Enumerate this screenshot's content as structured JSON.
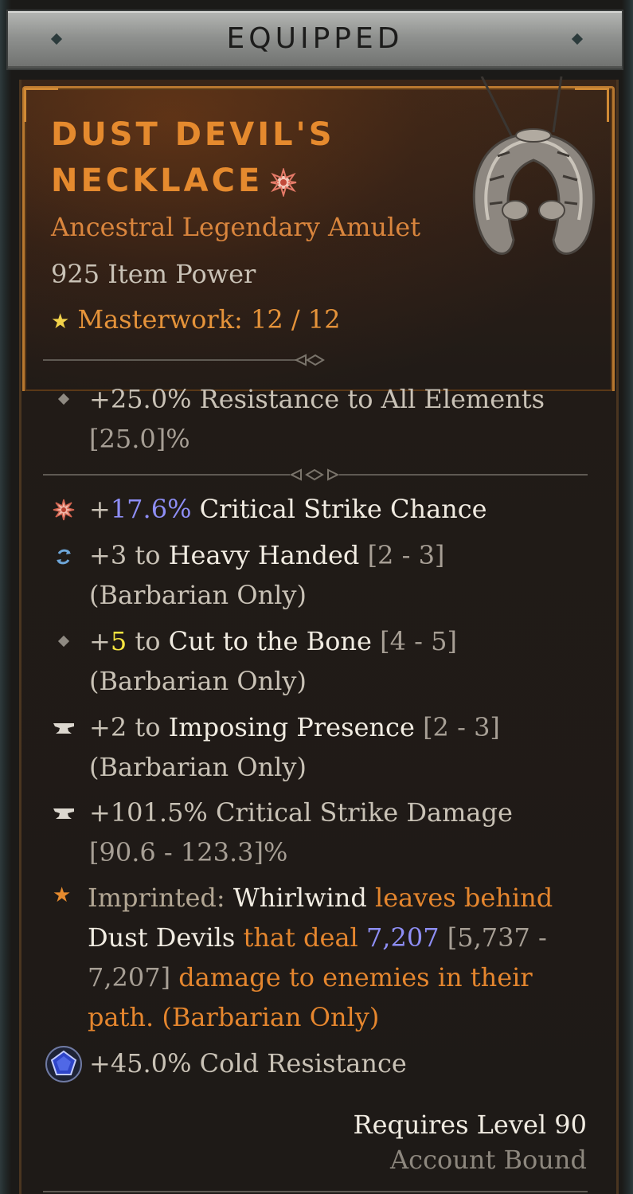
{
  "header": {
    "title": "EQUIPPED"
  },
  "item": {
    "name_line1": "DUST DEVIL'S",
    "name_line2": "NECKLACE",
    "greater_icon": "greater-affix-icon",
    "type": "Ancestral Legendary Amulet",
    "item_power": "925 Item Power",
    "masterwork_label": "Masterwork: 12 / 12",
    "masterwork_icon": "star-icon"
  },
  "implicit": {
    "line1": "+25.0% Resistance to All Elements",
    "line2": "[25.0]%"
  },
  "affixes": [
    {
      "icon": "greater-affix-icon",
      "prefix": "+",
      "value": "17.6%",
      "rest": " Critical Strike Chance"
    },
    {
      "icon": "tempered-affix-icon",
      "prefix": "+3 to ",
      "name": "Heavy Handed",
      "range": " [2 - 3]",
      "line2": "(Barbarian Only)"
    },
    {
      "icon": "diamond-icon",
      "prefix": "+",
      "value": "5",
      "mid": " to ",
      "name": "Cut to the Bone",
      "range": " [4 - 5]",
      "line2": "(Barbarian Only)"
    },
    {
      "icon": "anvil-icon",
      "prefix": "+2 to ",
      "name": "Imposing Presence",
      "range": "  [2 - 3]",
      "line2": "(Barbarian Only)"
    },
    {
      "icon": "anvil-icon",
      "line1": "+101.5% Critical Strike Damage",
      "line2": "[90.6 - 123.3]%"
    }
  ],
  "aspect": {
    "icon": "star-icon",
    "label": "Imprinted: ",
    "skill": "Whirlwind",
    "t1": " leaves behind",
    "t2": "Dust Devils",
    "t3": " that deal ",
    "value": "7,207",
    "range1": " [5,737 -",
    "range2": "7,207]",
    "t4": " damage to enemies in their",
    "t5": "path. (Barbarian Only)"
  },
  "socket": {
    "icon": "sapphire-gem-icon",
    "text": "+45.0% Cold Resistance"
  },
  "footer": {
    "requires": "Requires Level 90",
    "bound": "Account Bound"
  },
  "colors": {
    "legendary": "#e58a2e",
    "blue_value": "#8e8ef5",
    "yellow_value": "#f6e540"
  }
}
